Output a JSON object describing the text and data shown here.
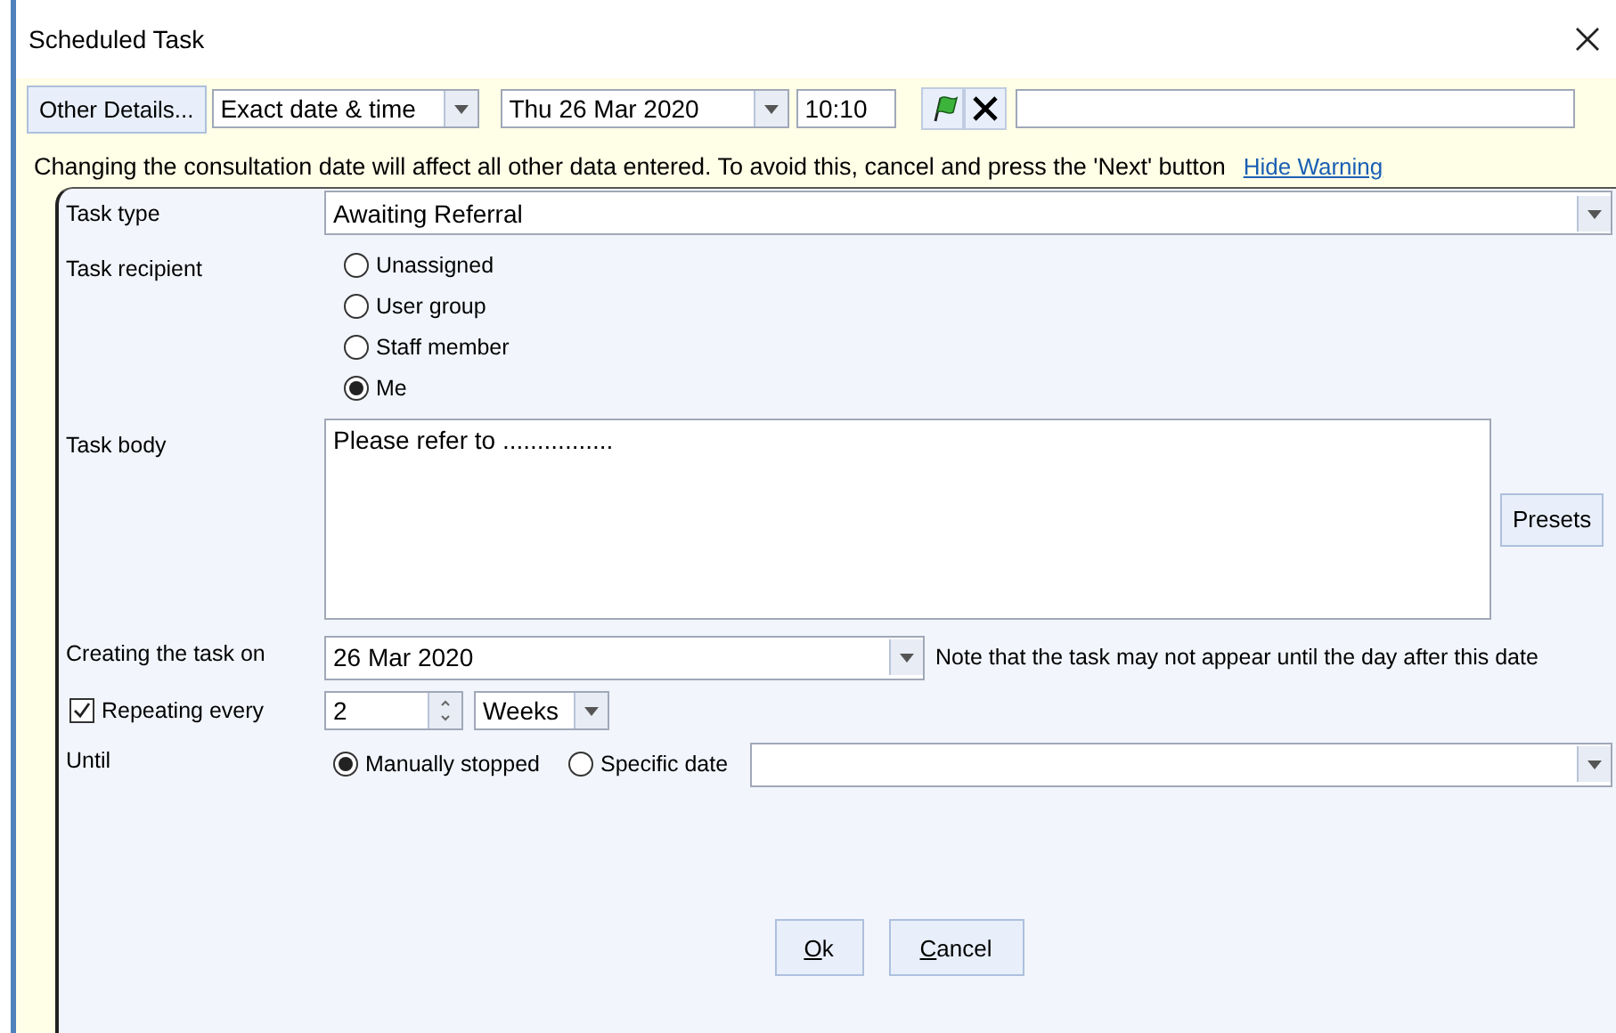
{
  "window": {
    "title": "Scheduled Task"
  },
  "toolbar": {
    "other_details_button": "Other Details...",
    "timing": "Exact date & time",
    "date": "Thu 26 Mar 2020",
    "time": "10:10"
  },
  "warning": {
    "text": "Changing the consultation date will affect all other data entered. To avoid this, cancel and press the 'Next' button",
    "link": "Hide Warning"
  },
  "form": {
    "task_type": {
      "label": "Task type",
      "value": "Awaiting Referral"
    },
    "task_recipient": {
      "label": "Task recipient",
      "options": [
        {
          "label": "Unassigned",
          "selected": false
        },
        {
          "label": "User group",
          "selected": false
        },
        {
          "label": "Staff member",
          "selected": false
        },
        {
          "label": "Me",
          "selected": true
        }
      ]
    },
    "task_body": {
      "label": "Task body",
      "value": "Please refer to ................",
      "presets_button": "Presets"
    },
    "creating": {
      "label": "Creating the task on",
      "value": "26 Mar 2020",
      "note": "Note that the task may not appear until the day after this date"
    },
    "repeating": {
      "label": "Repeating every",
      "checked": true,
      "value": "2",
      "unit": "Weeks"
    },
    "until": {
      "label": "Until",
      "options": [
        {
          "label": "Manually stopped",
          "selected": true
        },
        {
          "label": "Specific date",
          "selected": false
        }
      ]
    }
  },
  "buttons": [
    {
      "label": "Ok"
    },
    {
      "label": "Cancel"
    }
  ]
}
